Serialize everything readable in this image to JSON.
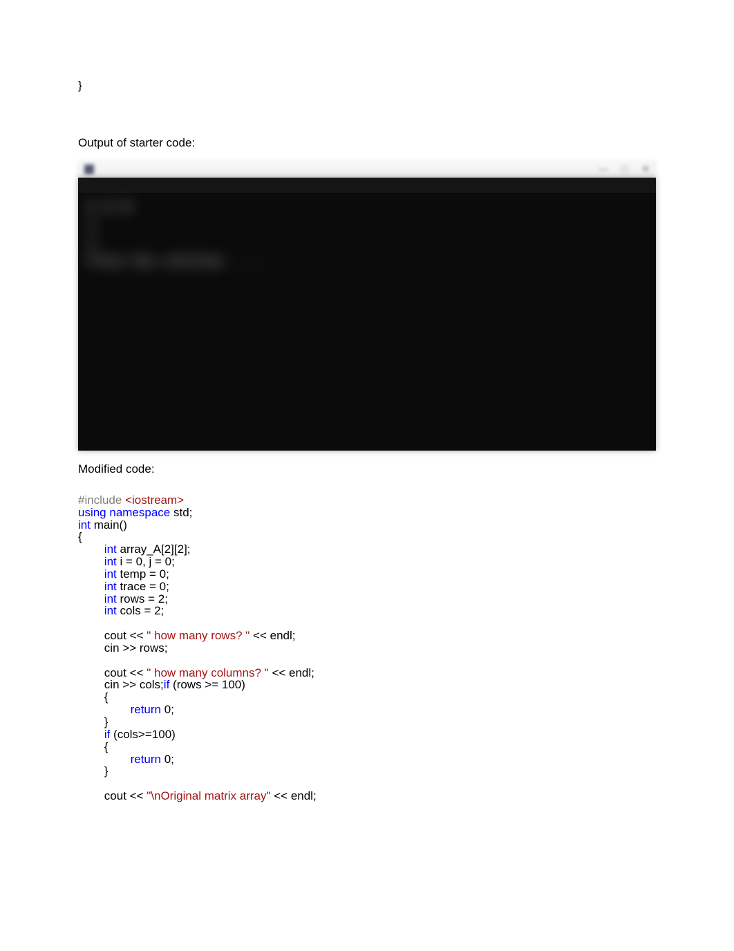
{
  "topBrace": "}",
  "sectionLabel1": "Output of starter code:",
  "console": {
    "titlebar": "",
    "blurText1": "1  3  5",
    "blurText2": "1",
    "blurText3": "2",
    "blurText4": "Press key continue . . ."
  },
  "sectionLabel2": "Modified code:",
  "code": {
    "l1_gray": "#include ",
    "l1_red": "<iostream>",
    "l2_blue": "using namespace ",
    "l2_txt": "std;",
    "l3_blue": "int ",
    "l3_txt": "main()",
    "l4": "{",
    "l5_blue": "int ",
    "l5_txt": "array_A[2][2];",
    "l6_blue": "int ",
    "l6_txt": "i = 0, j = 0;",
    "l7_blue": "int ",
    "l7_txt": "temp = 0;",
    "l8_blue": "int ",
    "l8_txt": "trace = 0;",
    "l9_blue": "int ",
    "l9_txt": "rows = 2;",
    "l10_blue": "int ",
    "l10_txt": "cols = 2;",
    "l12_txt1": "cout << ",
    "l12_red": "\" how many rows? \"",
    "l12_txt2": " << endl;",
    "l13_txt": "cin >> rows;",
    "l15_txt1": "cout << ",
    "l15_red": "\" how many columns? \"",
    "l15_txt2": " << endl;",
    "l16_txt1": "cin >> cols;",
    "l16_blue": "if ",
    "l16_txt2": "(rows >= 100)",
    "l17": "{",
    "l18_blue": "return ",
    "l18_txt": "0;",
    "l19": "}",
    "l20_blue": "if ",
    "l20_txt": "(cols>=100)",
    "l21": "{",
    "l22_blue": "return ",
    "l22_txt": "0;",
    "l23": "}",
    "l25_txt1": "cout << ",
    "l25_red": "\"\\nOriginal matrix array\"",
    "l25_txt2": " << endl;"
  }
}
